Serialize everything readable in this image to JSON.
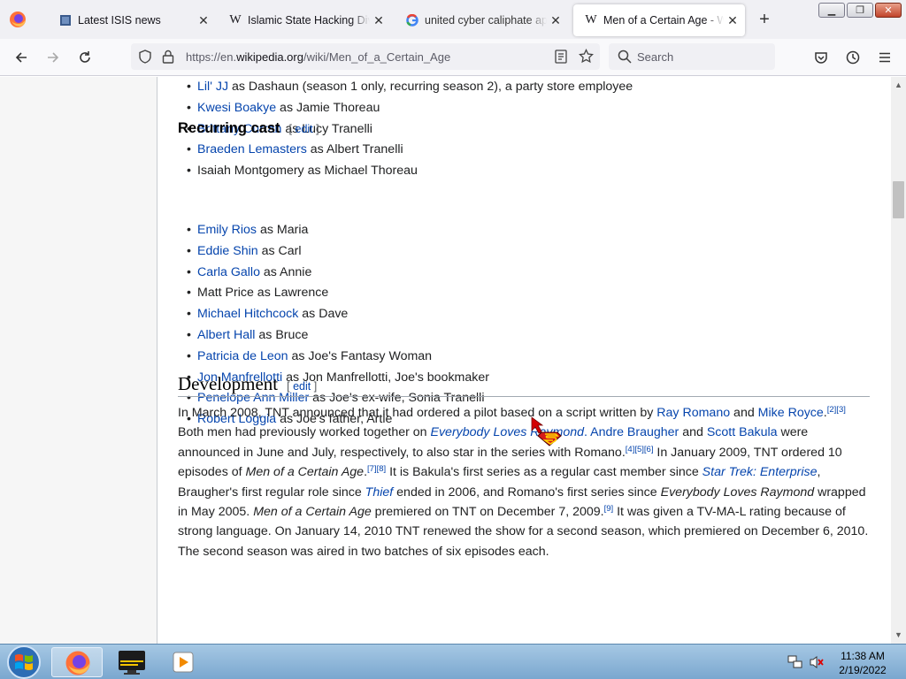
{
  "browser": {
    "tabs": [
      {
        "title": "Latest ISIS news",
        "favicon": "generic-site-icon"
      },
      {
        "title": "Islamic State Hacking Divis",
        "favicon": "wikipedia-icon"
      },
      {
        "title": "united cyber caliphate apt",
        "favicon": "google-icon"
      },
      {
        "title": "Men of a Certain Age - Wik",
        "favicon": "wikipedia-icon",
        "active": true
      }
    ],
    "url_prefix": "https://en.",
    "url_domain": "wikipedia.org",
    "url_path": "/wiki/Men_of_a_Certain_Age",
    "search_placeholder": "Search"
  },
  "article": {
    "main_cast_tail": [
      {
        "link": "Lil' JJ",
        "text": " as Dashaun (season 1 only, recurring season 2), a party store employee"
      },
      {
        "link": "Kwesi Boakye",
        "text": " as Jamie Thoreau"
      },
      {
        "link": "Brittany Curran",
        "text": " as Lucy Tranelli"
      },
      {
        "link": "Braeden Lemasters",
        "text": " as Albert Tranelli"
      },
      {
        "link": "",
        "text": "Isaiah Montgomery as Michael Thoreau"
      }
    ],
    "recurring_heading": "Recurring cast",
    "edit_open": "[ ",
    "edit_label": "edit",
    "edit_close": " ]",
    "recurring_cast": [
      {
        "link": "Emily Rios",
        "text": " as Maria"
      },
      {
        "link": "Eddie Shin",
        "text": " as Carl"
      },
      {
        "link": "Carla Gallo",
        "text": " as Annie"
      },
      {
        "link": "",
        "text": "Matt Price as Lawrence"
      },
      {
        "link": "Michael Hitchcock",
        "text": " as Dave"
      },
      {
        "link": "Albert Hall",
        "text": " as Bruce"
      },
      {
        "link": "Patricia de Leon",
        "text": " as Joe's Fantasy Woman"
      },
      {
        "link": "Jon Manfrellotti",
        "text": " as Jon Manfrellotti, Joe's bookmaker"
      },
      {
        "link": "Penelope Ann Miller",
        "text": " as Joe's ex-wife, Sonia Tranelli"
      },
      {
        "link": "Robert Loggia",
        "text": " as Joe's father, Artie"
      }
    ],
    "development_heading": "Development",
    "development_paragraph": [
      {
        "t": "In March 2008, TNT announced that it had ordered a pilot based on a script written by "
      },
      {
        "t": "Ray Romano",
        "k": "link"
      },
      {
        "t": " and "
      },
      {
        "t": "Mike Royce",
        "k": "link"
      },
      {
        "t": ".",
        "k": "text"
      },
      {
        "t": "[2][3]",
        "k": "sup"
      },
      {
        "t": " Both men had previously worked together on "
      },
      {
        "t": "Everybody Loves Raymond",
        "k": "ilink"
      },
      {
        "t": ". ",
        "k": "link"
      },
      {
        "t": "Andre Braugher",
        "k": "link"
      },
      {
        "t": " and "
      },
      {
        "t": "Scott Bakula",
        "k": "link"
      },
      {
        "t": " were announced in June and July, respectively, to also star in the series with Romano."
      },
      {
        "t": "[4][5][6]",
        "k": "sup"
      },
      {
        "t": " In January 2009, TNT ordered 10 episodes of "
      },
      {
        "t": "Men of a Certain Age",
        "k": "i"
      },
      {
        "t": "."
      },
      {
        "t": "[7][8]",
        "k": "sup"
      },
      {
        "t": " It is Bakula's first series as a regular cast member since "
      },
      {
        "t": "Star Trek: Enterprise",
        "k": "ilink"
      },
      {
        "t": ", Braugher's first regular role since "
      },
      {
        "t": "Thief",
        "k": "ilink"
      },
      {
        "t": " ended in 2006, and Romano's first series since "
      },
      {
        "t": "Everybody Loves Raymond",
        "k": "i"
      },
      {
        "t": " wrapped in May 2005. "
      },
      {
        "t": "Men of a Certain Age",
        "k": "i"
      },
      {
        "t": " premiered on TNT on December 7, 2009."
      },
      {
        "t": "[9]",
        "k": "sup"
      },
      {
        "t": " It was given a TV-MA-L rating because of strong language. On January 14, 2010 TNT renewed the show for a second season, which premiered on December 6, 2010. The second season was aired in two batches of six episodes each."
      }
    ]
  },
  "taskbar": {
    "time": "11:38 AM",
    "date": "2/19/2022"
  },
  "colors": {
    "link": "#0645ad",
    "text": "#202122",
    "taskbar": "#7aa7cf"
  }
}
